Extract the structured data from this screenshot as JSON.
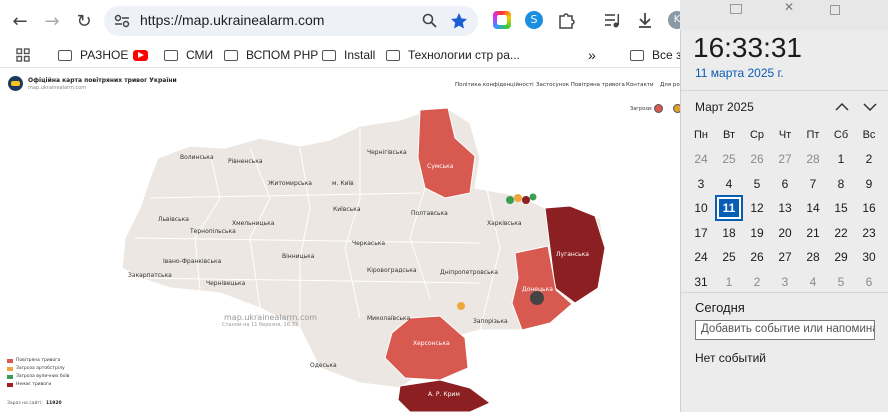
{
  "browser": {
    "url": "https://map.ukrainealarm.com",
    "profile_initial": "K"
  },
  "bookmarks": [
    {
      "label": "РАЗНОЕ",
      "icon": "folder-icon"
    },
    {
      "label": "",
      "icon": "youtube-icon"
    },
    {
      "label": "СМИ",
      "icon": "folder-icon"
    },
    {
      "label": "ВСПОМ PHP",
      "icon": "folder-icon"
    },
    {
      "label": "Install",
      "icon": "folder-icon"
    },
    {
      "label": "Технологии стр ра...",
      "icon": "folder-icon"
    },
    {
      "label": "Все за",
      "icon": "folder-icon"
    }
  ],
  "site": {
    "title": "Офіційна карта повітряних тривог України",
    "subtitle": "map.ukrainealarm.com",
    "nav": [
      "Політика конфіденційності",
      "Застосунок Повітряна тривога",
      "Контакти",
      "Для ро"
    ],
    "threats_label": "Загрози:",
    "watermark_url": "map.ukrainealarm.com",
    "watermark_time": "Станом на 11 березня, 16:33",
    "legend": [
      {
        "label": "Повітряна тривога",
        "color": "#d8594f"
      },
      {
        "label": "Загроза артобстрілу",
        "color": "#f0a63c"
      },
      {
        "label": "Загроза вуличних боїв",
        "color": "#3b9d53"
      },
      {
        "label": "Немає тривоги",
        "color": "#a11f22"
      }
    ],
    "visits_label": "Зараз на сайті:",
    "visits_count": "11920",
    "regions": {
      "volynska": "Волинська",
      "rivnenska": "Рівненська",
      "zhytomyrska": "Житомирська",
      "kyiv": "м. Київ",
      "chernihivska": "Чернігівська",
      "sumska": "Сумська",
      "lvivska": "Львівська",
      "khmelnytska": "Хмельницька",
      "ternopilska": "Тернопільська",
      "kyivska": "Київська",
      "poltavska": "Полтавська",
      "kharkivska": "Харківська",
      "luhanska": "Луганська",
      "ivanofrankivska": "Івано-Франківська",
      "vinnytska": "Вінницька",
      "cherkaska": "Черкаська",
      "zakarpatska": "Закарпатська",
      "chernivetska": "Чернівецька",
      "kirovohradska": "Кіровоградська",
      "dnipropetrovska": "Дніпропетровська",
      "donetska": "Донецька",
      "zaporizka": "Запорізька",
      "mykolaivska": "Миколаївська",
      "khersonska": "Херсонська",
      "odeska": "Одеська",
      "krym": "А. Р. Крим"
    }
  },
  "calendar": {
    "time": "16:33:31",
    "date": "11 марта 2025 г.",
    "month": "Март 2025",
    "weekdays": [
      "Пн",
      "Вт",
      "Ср",
      "Чт",
      "Пт",
      "Сб",
      "Вс"
    ],
    "days": [
      [
        "24",
        "25",
        "26",
        "27",
        "28",
        "1",
        "2"
      ],
      [
        "3",
        "4",
        "5",
        "6",
        "7",
        "8",
        "9"
      ],
      [
        "10",
        "11",
        "12",
        "13",
        "14",
        "15",
        "16"
      ],
      [
        "17",
        "18",
        "19",
        "20",
        "21",
        "22",
        "23"
      ],
      [
        "24",
        "25",
        "26",
        "27",
        "28",
        "29",
        "30"
      ],
      [
        "31",
        "1",
        "2",
        "3",
        "4",
        "5",
        "6"
      ]
    ],
    "today_label": "Сегодня",
    "event_placeholder": "Добавить событие или напоминание",
    "no_events": "Нет событий"
  }
}
